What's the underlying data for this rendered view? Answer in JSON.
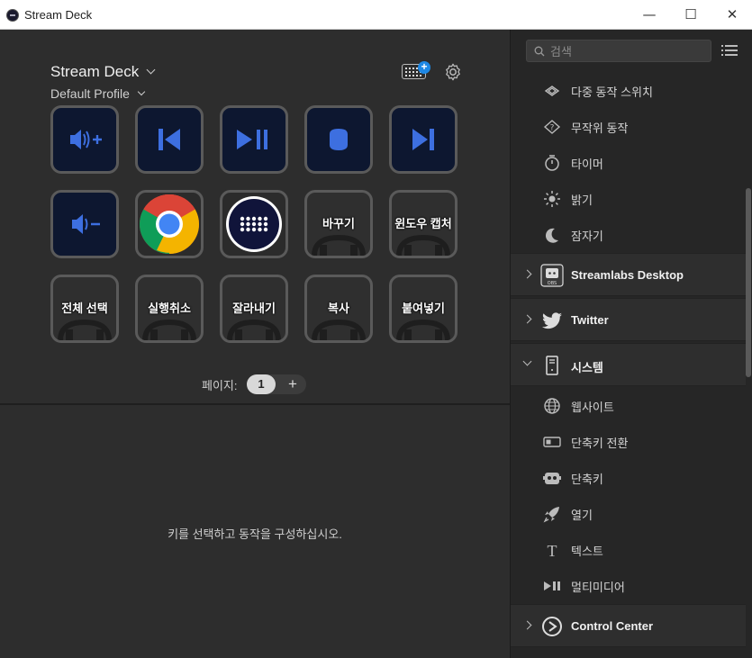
{
  "window": {
    "title": "Stream Deck",
    "minimize_glyph": "—",
    "maximize_glyph": "☐",
    "close_glyph": "✕"
  },
  "device": {
    "name": "Stream Deck",
    "profile": "Default Profile"
  },
  "keys": [
    {
      "name": "volume-up-key",
      "icon": "volume-up-icon",
      "label": ""
    },
    {
      "name": "previous-track-key",
      "icon": "previous-track-icon",
      "label": ""
    },
    {
      "name": "play-pause-key",
      "icon": "play-pause-icon",
      "label": ""
    },
    {
      "name": "stop-key",
      "icon": "stop-icon",
      "label": ""
    },
    {
      "name": "next-track-key",
      "icon": "next-track-icon",
      "label": ""
    },
    {
      "name": "volume-down-key",
      "icon": "volume-down-icon",
      "label": ""
    },
    {
      "name": "chrome-key",
      "icon": "chrome-icon",
      "label": ""
    },
    {
      "name": "stream-deck-app-key",
      "icon": "stream-deck-icon",
      "label": ""
    },
    {
      "name": "replace-key",
      "icon": "",
      "label": "바꾸기"
    },
    {
      "name": "window-capture-key",
      "icon": "",
      "label": "윈도우 캡처"
    },
    {
      "name": "select-all-key",
      "icon": "",
      "label": "전체 선택"
    },
    {
      "name": "undo-key",
      "icon": "",
      "label": "실행취소"
    },
    {
      "name": "cut-key",
      "icon": "",
      "label": "잘라내기"
    },
    {
      "name": "copy-key",
      "icon": "",
      "label": "복사"
    },
    {
      "name": "paste-key",
      "icon": "",
      "label": "붙여넣기"
    }
  ],
  "pager": {
    "label": "페이지:",
    "current": "1",
    "add": "+"
  },
  "hint": "키를 선택하고 동작을 구성하십시오.",
  "sidebar": {
    "search_placeholder": "검색",
    "items_top": [
      {
        "label": "다중 동작 스위치",
        "icon": "multi-action-switch-icon"
      },
      {
        "label": "무작위 동작",
        "icon": "random-action-icon"
      },
      {
        "label": "타이머",
        "icon": "timer-icon"
      },
      {
        "label": "밝기",
        "icon": "brightness-icon"
      },
      {
        "label": "잠자기",
        "icon": "sleep-icon"
      }
    ],
    "categories": [
      {
        "label": "Streamlabs Desktop",
        "icon": "streamlabs-obs-icon",
        "expanded": false
      },
      {
        "label": "Twitter",
        "icon": "twitter-icon",
        "expanded": false
      },
      {
        "label": "시스템",
        "icon": "system-icon",
        "expanded": true
      }
    ],
    "system_items": [
      {
        "label": "웹사이트",
        "icon": "website-icon"
      },
      {
        "label": "단축키 전환",
        "icon": "hotkey-switch-icon"
      },
      {
        "label": "단축키",
        "icon": "hotkey-icon"
      },
      {
        "label": "열기",
        "icon": "open-icon"
      },
      {
        "label": "텍스트",
        "icon": "text-icon"
      },
      {
        "label": "멀티미디어",
        "icon": "multimedia-icon"
      }
    ],
    "bottom_category": {
      "label": "Control Center",
      "icon": "control-center-icon",
      "expanded": false
    }
  },
  "colors": {
    "accent": "#1e88e5",
    "key_blue": "#3d6fe0",
    "key_bg": "#0d1730"
  }
}
